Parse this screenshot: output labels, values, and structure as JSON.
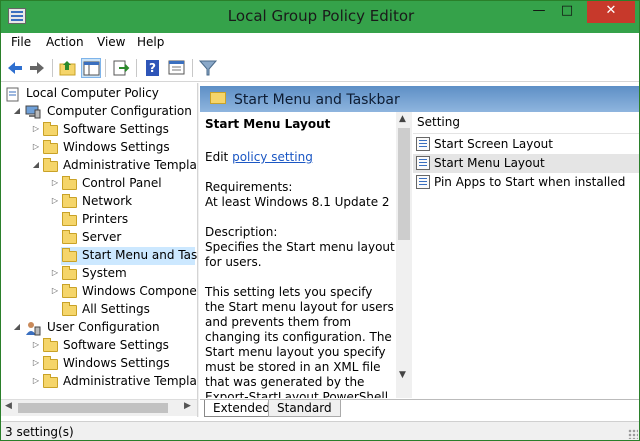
{
  "window": {
    "title": "Local Group Policy Editor",
    "accent": "#35a24a"
  },
  "menu": [
    "File",
    "Action",
    "View",
    "Help"
  ],
  "toolbar": {
    "icons": [
      "back-arrow-icon",
      "forward-arrow-icon",
      "folder-up-icon",
      "show-hide-tree-icon",
      "export-list-icon",
      "help-icon",
      "properties-icon",
      "filter-icon"
    ]
  },
  "tree": {
    "root": "Local Computer Policy",
    "computer": "Computer Configuration",
    "software": "Software Settings",
    "windows": "Windows Settings",
    "admin": "Administrative Template",
    "control_panel": "Control Panel",
    "network": "Network",
    "printers": "Printers",
    "server": "Server",
    "start_menu": "Start Menu and Taskb",
    "system": "System",
    "windows_components": "Windows Componen",
    "all_settings": "All Settings",
    "user": "User Configuration",
    "user_software": "Software Settings",
    "user_windows": "Windows Settings",
    "user_admin": "Administrative Template"
  },
  "right": {
    "header": "Start Menu and Taskbar",
    "desc_title": "Start Menu Layout",
    "edit_prefix": "Edit",
    "edit_link": "policy setting",
    "req_label": "Requirements:",
    "req_value": "At least Windows 8.1 Update 2",
    "desc_label": "Description:",
    "desc_line1": "Specifies the Start menu layout for users.",
    "desc_body": "This setting lets you specify the Start menu layout for users and prevents them from changing its configuration. The Start menu layout you specify must be stored in an XML file that was generated by the Export-StartLayout PowerShell cmdlet."
  },
  "list": {
    "column": "Setting",
    "items": [
      "Start Screen Layout",
      "Start Menu Layout",
      "Pin Apps to Start when installed"
    ]
  },
  "tabs": {
    "extended": "Extended",
    "standard": "Standard"
  },
  "status": {
    "text": "3 setting(s)"
  }
}
